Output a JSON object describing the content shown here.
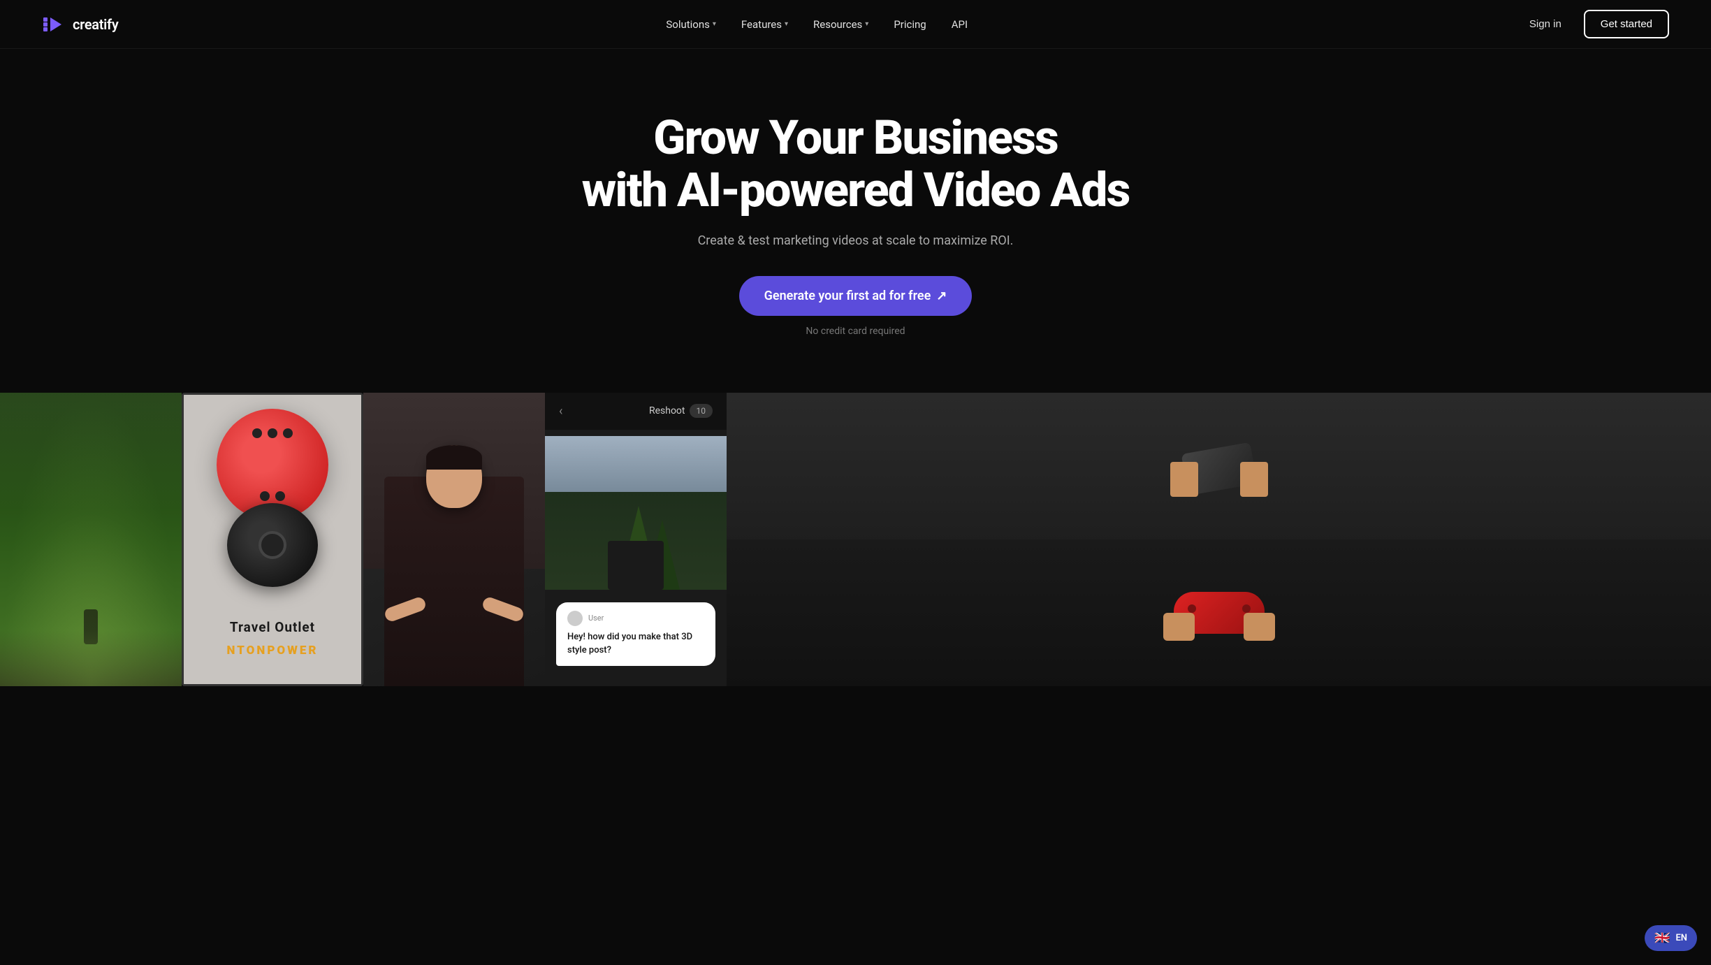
{
  "brand": {
    "name": "creatify",
    "logo_alt": "Creatify logo"
  },
  "navbar": {
    "solutions_label": "Solutions",
    "features_label": "Features",
    "resources_label": "Resources",
    "pricing_label": "Pricing",
    "api_label": "API",
    "signin_label": "Sign in",
    "get_started_label": "Get started"
  },
  "hero": {
    "title_line1": "Grow Your Business",
    "title_line2": "with AI-powered Video Ads",
    "subtitle": "Create & test marketing videos at scale to maximize ROI.",
    "cta_label": "Generate your first ad for free",
    "cta_note": "No credit card required"
  },
  "gallery": {
    "cards": [
      {
        "id": "forest",
        "type": "forest-runner",
        "alt": "Forest runner video ad"
      },
      {
        "id": "product",
        "type": "product-ad",
        "alt": "Travel outlet product ad",
        "label": "Travel Outlet",
        "brand": "NTONPOWER"
      },
      {
        "id": "presenter",
        "type": "presenter",
        "alt": "Presenter video ad"
      },
      {
        "id": "chat",
        "type": "chat-ui",
        "alt": "Chat UI reshoot interface",
        "reshoot_label": "Reshoot",
        "reshoot_count": "10",
        "chat_question": "Hey! how did you make that 3D style post?"
      },
      {
        "id": "hands",
        "type": "hands-device",
        "alt": "Hands holding device video ad"
      }
    ]
  },
  "lang_badge": {
    "flag": "🇬🇧",
    "code": "EN"
  }
}
